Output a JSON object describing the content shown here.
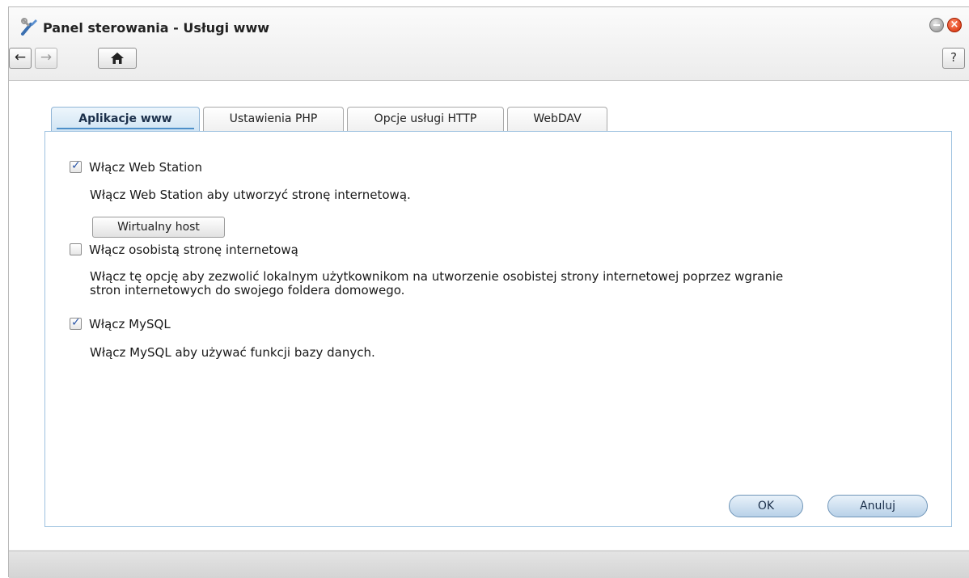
{
  "window": {
    "title": "Panel sterowania - Usługi www",
    "help_label": "?",
    "close_label": "×"
  },
  "toolbar": {
    "back_icon": "←",
    "forward_icon": "→",
    "home_icon": "⌂"
  },
  "tabs": [
    {
      "label": "Aplikacje www",
      "active": true
    },
    {
      "label": "Ustawienia PHP",
      "active": false
    },
    {
      "label": "Opcje usługi HTTP",
      "active": false
    },
    {
      "label": "WebDAV",
      "active": false
    }
  ],
  "options": {
    "web_station": {
      "label": "Włącz Web Station",
      "checked": true,
      "description": "Włącz Web Station aby utworzyć stronę internetową.",
      "button_label": "Wirtualny host"
    },
    "personal_site": {
      "label": "Włącz osobistą stronę internetową",
      "checked": false,
      "description_line1": "Włącz tę opcję aby zezwolić lokalnym użytkownikom na utworzenie osobistej strony internetowej poprzez wgranie",
      "description_line2": "stron internetowych do swojego foldera domowego."
    },
    "mysql": {
      "label": "Włącz MySQL",
      "checked": true,
      "description": "Włącz MySQL aby używać funkcji bazy danych."
    }
  },
  "actions": {
    "ok_label": "OK",
    "cancel_label": "Anuluj"
  },
  "colors": {
    "accent": "#4d8fc9",
    "panel_border": "#9ec2e0",
    "close": "#d42a00"
  }
}
